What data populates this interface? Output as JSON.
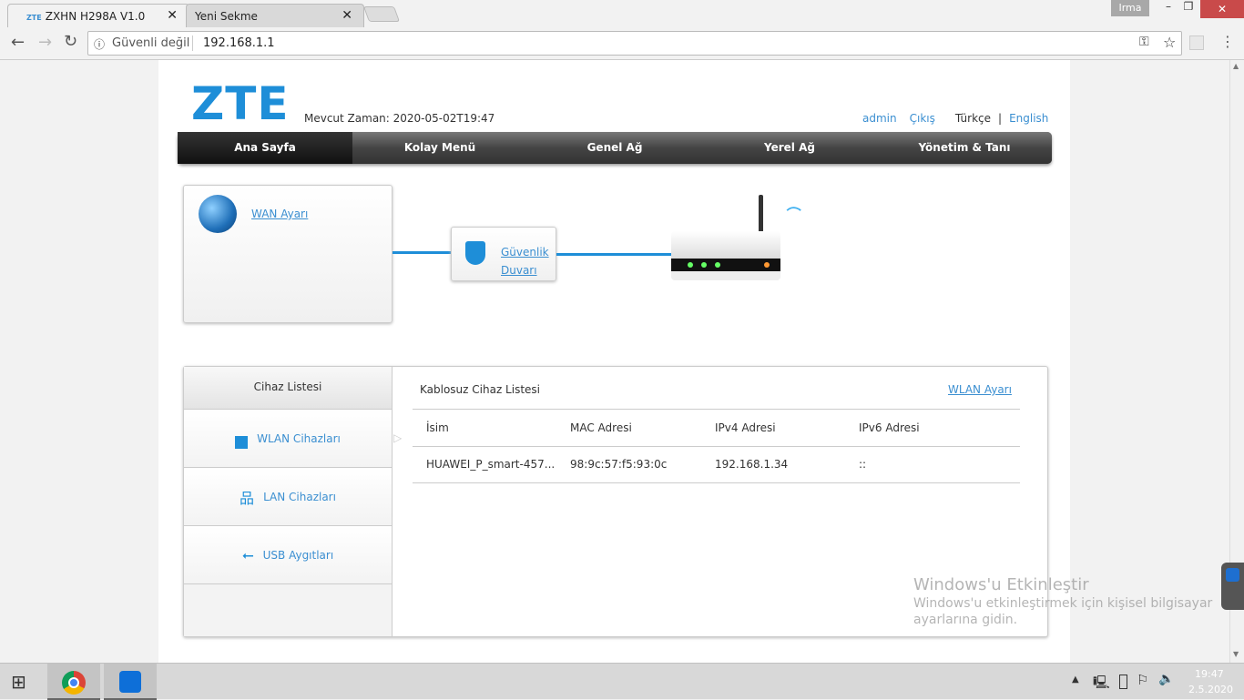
{
  "browser": {
    "tabs": [
      {
        "label": "ZXHN H298A V1.0",
        "favicon": "ZTE"
      },
      {
        "label": "Yeni Sekme"
      }
    ],
    "user": "Irma",
    "security": "Güvenli değil",
    "url": "192.168.1.1"
  },
  "header": {
    "logo": "ZTE",
    "time_label": "Mevcut Zaman: 2020-05-02T19:47",
    "admin": "admin",
    "logout": "Çıkış",
    "lang_tr": "Türkçe",
    "sep": "|",
    "lang_en": "English"
  },
  "nav": [
    "Ana Sayfa",
    "Kolay Menü",
    "Genel Ağ",
    "Yerel Ağ",
    "Yönetim & Tanı"
  ],
  "topology": {
    "wan": "WAN Ayarı",
    "firewall_1": "Güvenlik",
    "firewall_2": "Duvarı"
  },
  "devices": {
    "title": "Cihaz Listesi",
    "items": [
      "WLAN Cihazları",
      "LAN Cihazları",
      "USB Aygıtları"
    ],
    "list_title": "Kablosuz Cihaz Listesi",
    "wlan_link": "WLAN Ayarı",
    "columns": [
      "İsim",
      "MAC Adresi",
      "IPv4 Adresi",
      "IPv6 Adresi"
    ],
    "rows": [
      [
        "HUAWEI_P_smart-457...",
        "98:9c:57:f5:93:0c",
        "192.168.1.34",
        "::"
      ]
    ]
  },
  "watermark": {
    "title": "Windows'u Etkinleştir",
    "line1": "Windows'u etkinleştirmek için kişisel bilgisayar",
    "line2": "ayarlarına gidin."
  },
  "taskbar": {
    "time": "19:47",
    "date": "2.5.2020"
  }
}
